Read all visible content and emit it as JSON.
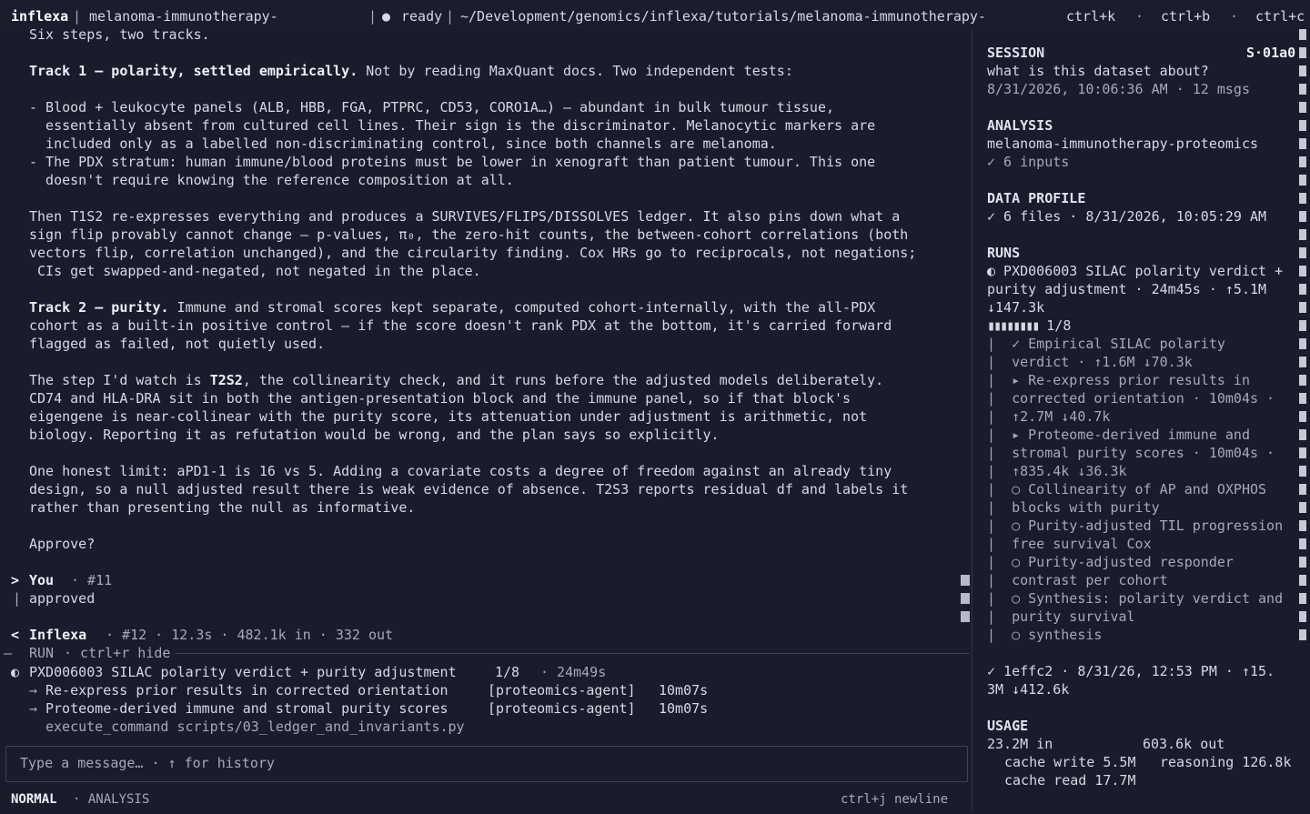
{
  "topbar": {
    "app": "inflexa",
    "tab_title": "melanoma-immunotherapy-",
    "status": "ready",
    "path": "~/Development/genomics/inflexa/tutorials/melanoma-immunotherapy-",
    "shortcuts": [
      "ctrl+k",
      "ctrl+b",
      "ctrl+c"
    ]
  },
  "transcript": {
    "intro": "Six steps, two tracks.",
    "track1_title": "Track 1 — polarity, settled empirically.",
    "track1_rest": " Not by reading MaxQuant docs. Two independent tests:",
    "bullets": [
      "- Blood + leukocyte panels (ALB, HBB, FGA, PTPRC, CD53, CORO1A…) — abundant in bulk tumour tissue,",
      "  essentially absent from cultured cell lines. Their sign is the discriminator. Melanocytic markers are",
      "  included only as a labelled non-discriminating control, since both channels are melanoma.",
      "- The PDX stratum: human immune/blood proteins must be lower in xenograft than patient tumour. This one",
      "  doesn't require knowing the reference composition at all."
    ],
    "para2": [
      "Then T1S2 re-expresses everything and produces a SURVIVES/FLIPS/DISSOLVES ledger. It also pins down what a",
      "sign flip provably cannot change — p-values, π₀, the zero-hit counts, the between-cohort correlations (both",
      "vectors flip, correlation unchanged), and the circularity finding. Cox HRs go to reciprocals, not negations;",
      " CIs get swapped-and-negated, not negated in the place."
    ],
    "track2_title": "Track 2 — purity.",
    "track2_line1": " Immune and stromal scores kept separate, computed cohort-internally, with the all-PDX",
    "track2_lines": [
      "cohort as a built-in positive control — if the score doesn't rank PDX at the bottom, it's carried forward",
      "flagged as failed, not quietly used."
    ],
    "para4_pre": "The step I'd watch is ",
    "para4_bold": "T2S2",
    "para4_post": ", the collinearity check, and it runs before the adjusted models deliberately.",
    "para4_lines": [
      "CD74 and HLA-DRA sit in both the antigen-presentation block and the immune panel, so if that block's",
      "eigengene is near-collinear with the purity score, its attenuation under adjustment is arithmetic, not",
      "biology. Reporting it as refutation would be wrong, and the plan says so explicitly."
    ],
    "para5": [
      "One honest limit: aPD1-1 is 16 vs 5. Adding a covariate costs a degree of freedom against an already tiny",
      "design, so a null adjusted result there is weak evidence of absence. T2S3 reports residual df and labels it",
      "rather than presenting the null as informative."
    ],
    "approve": "Approve?"
  },
  "messages": {
    "you_label": "You",
    "you_meta": "· #11",
    "you_text": "approved",
    "bot_label": "Inflexa",
    "bot_meta": "· #12 · 12.3s · 482.1k in · 332 out"
  },
  "run_panel": {
    "header": "RUN",
    "hide_hint": "· ctrl+r hide",
    "title": "PXD006003 SILAC polarity verdict + purity adjustment",
    "progress": "1/8",
    "elapsed": "· 24m49s",
    "steps": [
      {
        "label": "Re-express prior results in corrected orientation",
        "agent": "[proteomics-agent]",
        "time": "10m07s"
      },
      {
        "label": "Proteome-derived immune and stromal purity scores",
        "agent": "[proteomics-agent]",
        "time": "10m07s"
      }
    ],
    "command": "execute_command scripts/03_ledger_and_invariants.py"
  },
  "input": {
    "placeholder": "Type a message… · ↑ for history"
  },
  "statusbar": {
    "mode": "NORMAL",
    "context": "· ANALYSIS",
    "hint": "ctrl+j newline"
  },
  "sidebar": {
    "session_title": "SESSION",
    "session_id": "S·01a0",
    "session_question": "what is this dataset about?",
    "session_meta": "8/31/2026, 10:06:36 AM · 12 msgs",
    "analysis_title": "ANALYSIS",
    "analysis_name": "melanoma-immunotherapy-proteomics",
    "analysis_inputs": "✓ 6 inputs",
    "profile_title": "DATA PROFILE",
    "profile_meta": "✓ 6 files · 8/31/2026, 10:05:29 AM",
    "runs_title": "RUNS",
    "run_lines": [
      "◐ PXD006003 SILAC polarity verdict +",
      "purity adjustment · 24m45s · ↑5.1M",
      "↓147.3k"
    ],
    "run_progress_bar": "▮▮▮▮▮▮▮▮",
    "run_progress": "1/8",
    "tree": [
      "|  ✓ Empirical SILAC polarity",
      "|  verdict · ↑1.6M ↓70.3k",
      "|  ▸ Re-express prior results in",
      "|  corrected orientation · 10m04s ·",
      "|  ↑2.7M ↓40.7k",
      "|  ▸ Proteome-derived immune and",
      "|  stromal purity scores · 10m04s ·",
      "|  ↑835.4k ↓36.3k",
      "|  ○ Collinearity of AP and OXPHOS",
      "|  blocks with purity",
      "|  ○ Purity-adjusted TIL progression",
      "|  free survival Cox",
      "|  ○ Purity-adjusted responder",
      "|  contrast per cohort",
      "|  ○ Synthesis: polarity verdict and",
      "|  purity survival",
      "|  ○ synthesis"
    ],
    "commit_lines": [
      "✓ 1effc2 · 8/31/26, 12:53 PM · ↑15.",
      "3M ↓412.6k"
    ],
    "usage_title": "USAGE",
    "usage_in": "23.2M in",
    "usage_out": "603.6k out",
    "cache_write": "cache write 5.5M",
    "reasoning": "reasoning 126.8k",
    "cache_read": "cache read 17.7M"
  }
}
